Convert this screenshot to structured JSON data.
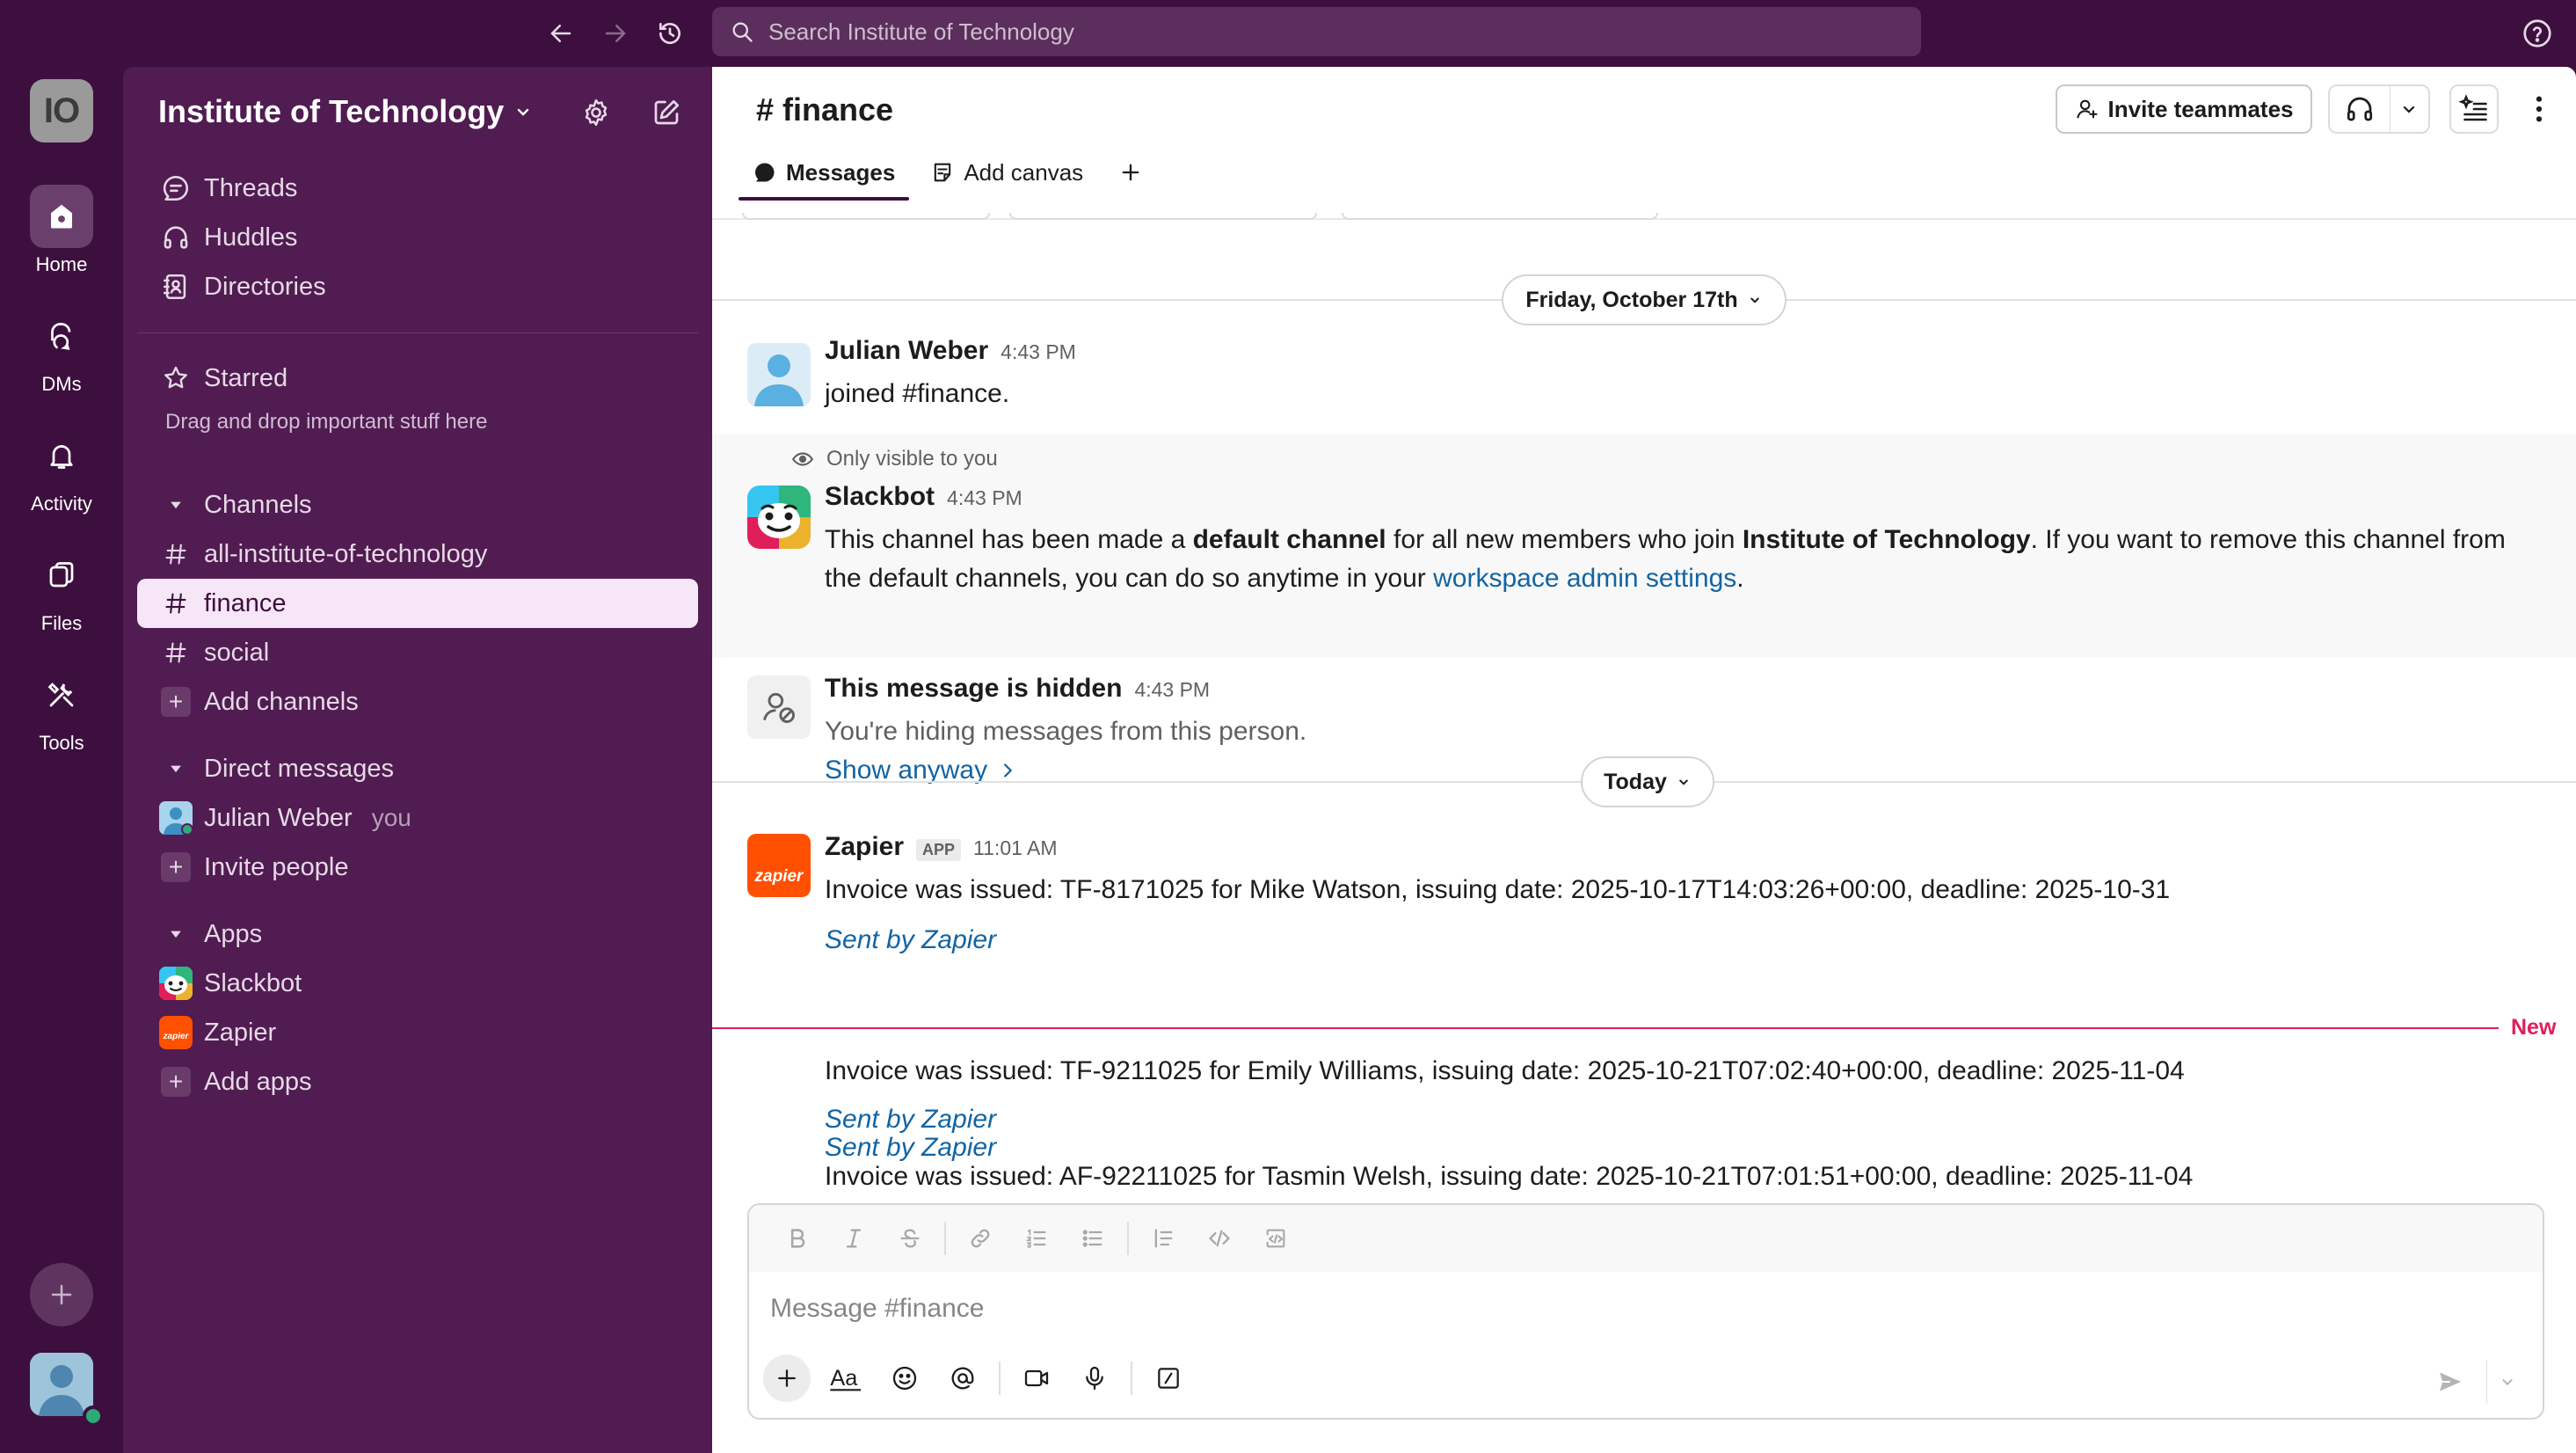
{
  "search": {
    "placeholder": "Search Institute of Technology"
  },
  "workspace": {
    "initials": "IO",
    "name": "Institute of Technology"
  },
  "rail": {
    "items": [
      {
        "label": "Home"
      },
      {
        "label": "DMs"
      },
      {
        "label": "Activity"
      },
      {
        "label": "Files"
      },
      {
        "label": "Tools"
      }
    ]
  },
  "sidebar": {
    "top_items": [
      {
        "label": "Threads"
      },
      {
        "label": "Huddles"
      },
      {
        "label": "Directories"
      }
    ],
    "starred": {
      "label": "Starred",
      "hint": "Drag and drop important stuff here"
    },
    "channels": {
      "label": "Channels",
      "items": [
        {
          "label": "all-institute-of-technology"
        },
        {
          "label": "finance"
        },
        {
          "label": "social"
        }
      ],
      "add": "Add channels"
    },
    "dms": {
      "label": "Direct messages",
      "user": "Julian Weber",
      "you": "you",
      "invite": "Invite people"
    },
    "apps": {
      "label": "Apps",
      "items": [
        {
          "label": "Slackbot"
        },
        {
          "label": "Zapier"
        }
      ],
      "add": "Add apps"
    }
  },
  "channel": {
    "title": "# finance",
    "invite_label": "Invite teammates",
    "tabs": [
      {
        "label": "Messages"
      },
      {
        "label": "Add canvas"
      }
    ]
  },
  "dividers": {
    "friday": "Friday, October 17th",
    "today": "Today"
  },
  "messages": {
    "julian": {
      "name": "Julian Weber",
      "time": "4:43 PM",
      "text": "joined #finance."
    },
    "slackbot": {
      "note": "Only visible to you",
      "name": "Slackbot",
      "time": "4:43 PM",
      "t1": "This channel has been made a ",
      "b1": "default channel",
      "t2": " for all new members who join ",
      "b2": "Institute of Technology",
      "t3": ". If you want to remove this channel from the default channels, you can do so anytime in your ",
      "link": "workspace admin settings",
      "t4": "."
    },
    "hidden": {
      "name": "This message is hidden",
      "time": "4:43 PM",
      "text": "You're hiding messages from this person.",
      "show": "Show anyway"
    },
    "zapier": {
      "name": "Zapier",
      "badge": "APP",
      "time": "11:01 AM",
      "avatar_text": "zapier",
      "new_label": "New",
      "items": [
        {
          "text": "Invoice was issued: TF-8171025 for Mike Watson, issuing date: 2025-10-17T14:03:26+00:00, deadline: 2025-10-31",
          "sent": "Sent by Zapier"
        },
        {
          "text": "Invoice was issued: TF-9211025 for Emily Williams, issuing date: 2025-10-21T07:02:40+00:00, deadline: 2025-11-04",
          "sent": "Sent by Zapier"
        },
        {
          "text": "Invoice was issued: AF-92211025 for Tasmin Welsh, issuing date: 2025-10-21T07:01:51+00:00, deadline: 2025-11-04",
          "sent": "Sent by Zapier"
        }
      ]
    }
  },
  "composer": {
    "placeholder": "Message #finance"
  },
  "colors": {
    "aubergine": "#3d0f3e",
    "sidebar": "#501c51",
    "active_row": "#f7e6f7",
    "link": "#1264a3",
    "new_marker": "#e01e5a",
    "zapier": "#ff4f00",
    "presence": "#2bac76"
  }
}
